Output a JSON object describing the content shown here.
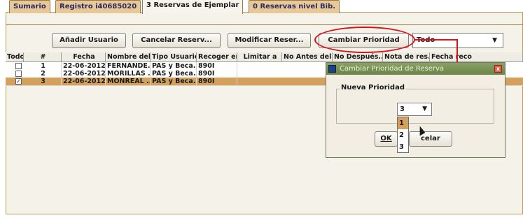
{
  "tabs": [
    {
      "label": "Sumario"
    },
    {
      "label": "Registro i40685020"
    },
    {
      "label": "3 Reservas de Ejemplar"
    },
    {
      "label": "0 Reservas nivel Bib."
    }
  ],
  "toolbar": {
    "add_user": "Añadir Usuario",
    "cancel_reserve": "Cancelar Reserv...",
    "modify_reserve": "Modificar Reser...",
    "change_priority": "Cambiar Prioridad",
    "filter_value": "Todo"
  },
  "columns": [
    "Todo",
    "#",
    "Fecha",
    "Nombre del ...",
    "Tipo Usuario",
    "Recoger en",
    "Limitar a",
    "No Antes del",
    "No Después...",
    "Nota de res...",
    "Fecha reco"
  ],
  "rows": [
    {
      "checked": "",
      "num": "1",
      "fecha": "22-06-2012...",
      "nombre": "FERNÁNDE...",
      "tipo": "PAS y Beca...",
      "recoger": "890I"
    },
    {
      "checked": "",
      "num": "2",
      "fecha": "22-06-2012...",
      "nombre": "MORILLAS ...",
      "tipo": "PAS y Beca...",
      "recoger": "890I"
    },
    {
      "checked": "✓",
      "num": "3",
      "fecha": "22-06-2012...",
      "nombre": "MONREAL ...",
      "tipo": "PAS y Beca...",
      "recoger": "890I"
    }
  ],
  "dialog": {
    "title": "Cambiar Prioridad de Reserva",
    "close": "x",
    "legend": "Nueva Prioridad",
    "selected": "3",
    "options": [
      "1",
      "2",
      "3"
    ],
    "ok": "OK",
    "cancel_partial": "celar"
  },
  "colors": {
    "accent": "#d4a15c",
    "annotation": "#d9131a",
    "dialog_title": "#6c8448"
  }
}
